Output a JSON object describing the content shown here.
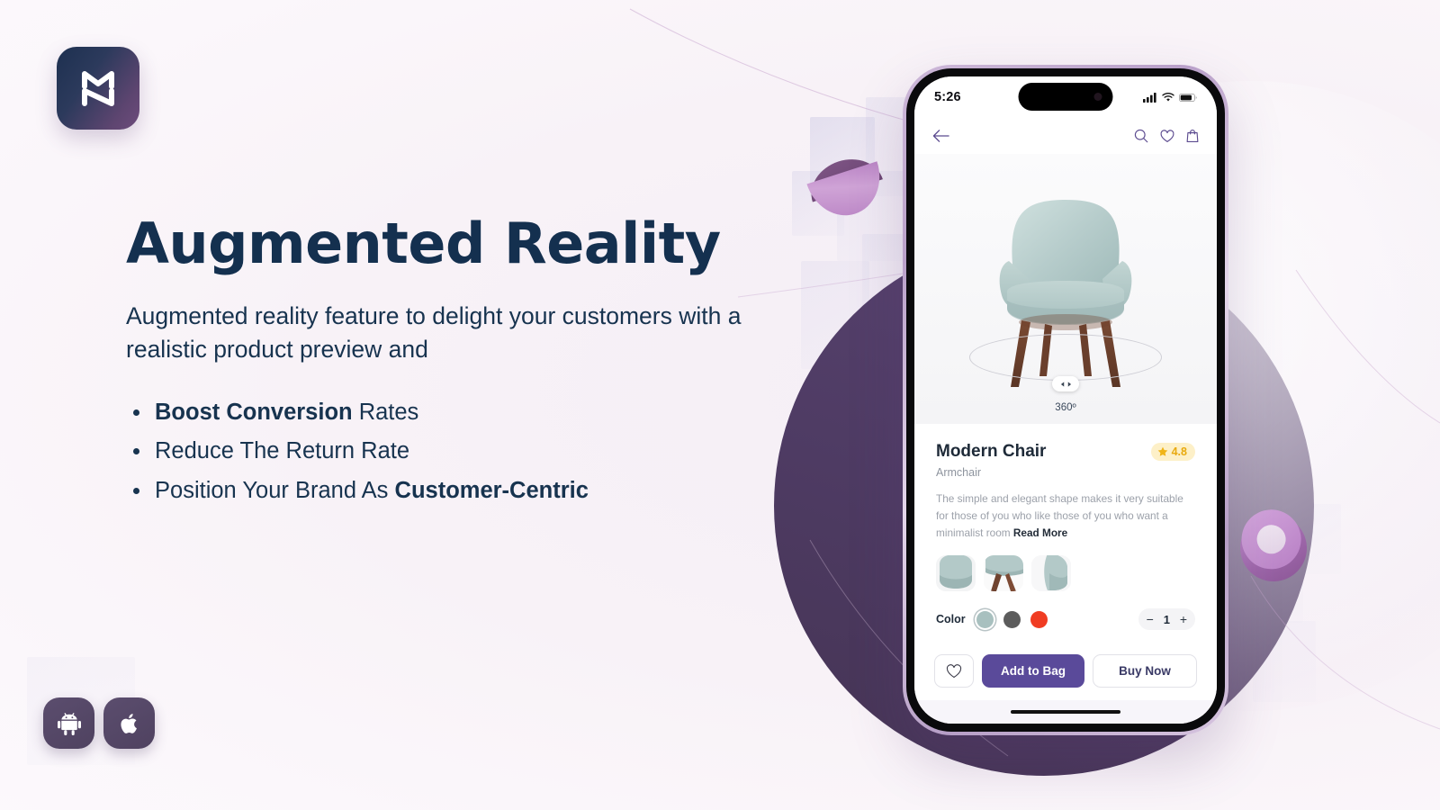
{
  "brand": {
    "logo_mark": "mn-monogram-logo"
  },
  "hero": {
    "headline": "Augmented Reality",
    "subtitle": "Augmented reality feature to delight your customers with a realistic product preview and",
    "bullets": [
      {
        "bold_prefix": "Boost Conversion",
        "rest": " Rates",
        "bold_suffix": ""
      },
      {
        "bold_prefix": "",
        "rest": "Reduce The Return Rate",
        "bold_suffix": ""
      },
      {
        "bold_prefix": "",
        "rest": "Position Your Brand As ",
        "bold_suffix": "Customer-Centric"
      }
    ]
  },
  "store_badges": [
    {
      "name": "android-badge",
      "icon": "android-icon"
    },
    {
      "name": "apple-badge",
      "icon": "apple-icon"
    }
  ],
  "phone": {
    "statusbar": {
      "time": "5:26",
      "icons": [
        "cellular-signal-icon",
        "wifi-icon",
        "battery-icon"
      ]
    },
    "navbar": {
      "back": "back-arrow-icon",
      "actions": [
        "search-icon",
        "heart-icon",
        "shopping-bag-icon"
      ]
    },
    "viewer": {
      "product_image": "modern-chair-sage-green",
      "rotate_label": "360º",
      "handle": "rotate-handle"
    },
    "product": {
      "title": "Modern Chair",
      "category": "Armchair",
      "rating": "4.8",
      "description": "The simple and elegant shape makes it very suitable for those of you who like those of you who want a minimalist room ",
      "read_more": "Read More",
      "thumbnails": [
        "chair-thumb-front",
        "chair-thumb-leg",
        "chair-thumb-side"
      ],
      "color_label": "Color",
      "colors": [
        {
          "name": "sage",
          "hex": "#a8c0bf",
          "selected": true
        },
        {
          "name": "charcoal",
          "hex": "#5c5c5c",
          "selected": false
        },
        {
          "name": "red",
          "hex": "#f03c22",
          "selected": false
        }
      ],
      "quantity": "1",
      "qty_minus": "−",
      "qty_plus": "+"
    },
    "actions": {
      "favorite": "heart-outline-icon",
      "add_to_bag": "Add to Bag",
      "buy_now": "Buy Now"
    }
  },
  "colors": {
    "headline": "#14304f",
    "accent_purple": "#5a4a9a",
    "badge_purple": "#5b4d6e",
    "rating_gold": "#e8a90e",
    "background": "#f8f3f8"
  }
}
